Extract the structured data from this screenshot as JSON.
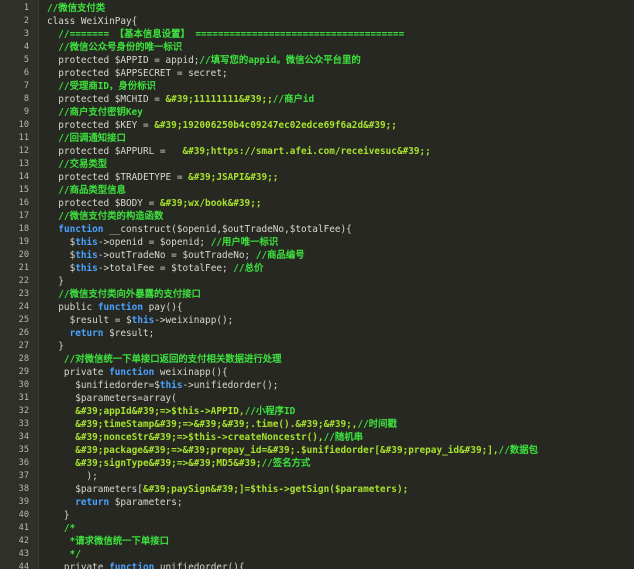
{
  "editor": {
    "lines": [
      {
        "n": "1",
        "tokens": [
          {
            "t": "//微信支付类",
            "c": "cm"
          }
        ]
      },
      {
        "n": "2",
        "tokens": [
          {
            "t": "class WeiXinPay{",
            "c": "pl"
          }
        ]
      },
      {
        "n": "3",
        "tokens": [
          {
            "t": "  //======= 【基本信息设置】 =====================================",
            "c": "cm"
          }
        ]
      },
      {
        "n": "4",
        "tokens": [
          {
            "t": "  //微信公众号身份的唯一标识",
            "c": "cm"
          }
        ]
      },
      {
        "n": "5",
        "tokens": [
          {
            "t": "  protected $APPID = appid;",
            "c": "pl"
          },
          {
            "t": "//填写您的appid。微信公众平台里的",
            "c": "cm"
          }
        ]
      },
      {
        "n": "6",
        "tokens": [
          {
            "t": "  protected $APPSECRET = secret;",
            "c": "pl"
          }
        ]
      },
      {
        "n": "7",
        "tokens": [
          {
            "t": "  //受理商ID，身份标识",
            "c": "cm"
          }
        ]
      },
      {
        "n": "8",
        "tokens": [
          {
            "t": "  protected $MCHID = ",
            "c": "pl"
          },
          {
            "t": "&#39;11111111&#39;;",
            "c": "st"
          },
          {
            "t": "//商户id",
            "c": "cm"
          }
        ]
      },
      {
        "n": "9",
        "tokens": [
          {
            "t": "  //商户支付密钥Key",
            "c": "cm"
          }
        ]
      },
      {
        "n": "10",
        "tokens": [
          {
            "t": "  protected $KEY = ",
            "c": "pl"
          },
          {
            "t": "&#39;192006250b4c09247ec02edce69f6a2d&#39;;",
            "c": "st"
          }
        ]
      },
      {
        "n": "11",
        "tokens": [
          {
            "t": "  //回调通知接口",
            "c": "cm"
          }
        ]
      },
      {
        "n": "12",
        "tokens": [
          {
            "t": "  protected $APPURL =   ",
            "c": "pl"
          },
          {
            "t": "&#39;https://smart.afei.com/receivesuc&#39;;",
            "c": "st"
          }
        ]
      },
      {
        "n": "13",
        "tokens": [
          {
            "t": "  //交易类型",
            "c": "cm"
          }
        ]
      },
      {
        "n": "14",
        "tokens": [
          {
            "t": "  protected $TRADETYPE = ",
            "c": "pl"
          },
          {
            "t": "&#39;JSAPI&#39;;",
            "c": "st"
          }
        ]
      },
      {
        "n": "15",
        "tokens": [
          {
            "t": "  //商品类型信息",
            "c": "cm"
          }
        ]
      },
      {
        "n": "16",
        "tokens": [
          {
            "t": "  protected $BODY = ",
            "c": "pl"
          },
          {
            "t": "&#39;wx/book&#39;;",
            "c": "st"
          }
        ]
      },
      {
        "n": "17",
        "tokens": [
          {
            "t": "  //微信支付类的构造函数",
            "c": "cm"
          }
        ]
      },
      {
        "n": "18",
        "tokens": [
          {
            "t": "  ",
            "c": "pl"
          },
          {
            "t": "function",
            "c": "kw"
          },
          {
            "t": " __construct($openid,$outTradeNo,$totalFee){",
            "c": "pl"
          }
        ]
      },
      {
        "n": "19",
        "tokens": [
          {
            "t": "    $",
            "c": "pl"
          },
          {
            "t": "this",
            "c": "kw"
          },
          {
            "t": "->openid = $openid; ",
            "c": "pl"
          },
          {
            "t": "//用户唯一标识",
            "c": "cm"
          }
        ]
      },
      {
        "n": "20",
        "tokens": [
          {
            "t": "    $",
            "c": "pl"
          },
          {
            "t": "this",
            "c": "kw"
          },
          {
            "t": "->outTradeNo = $outTradeNo; ",
            "c": "pl"
          },
          {
            "t": "//商品编号",
            "c": "cm"
          }
        ]
      },
      {
        "n": "21",
        "tokens": [
          {
            "t": "    $",
            "c": "pl"
          },
          {
            "t": "this",
            "c": "kw"
          },
          {
            "t": "->totalFee = $totalFee; ",
            "c": "pl"
          },
          {
            "t": "//总价",
            "c": "cm"
          }
        ]
      },
      {
        "n": "22",
        "tokens": [
          {
            "t": "  }",
            "c": "pl"
          }
        ]
      },
      {
        "n": "23",
        "tokens": [
          {
            "t": "  //微信支付类向外暴露的支付接口",
            "c": "cm"
          }
        ]
      },
      {
        "n": "24",
        "tokens": [
          {
            "t": "  public ",
            "c": "pl"
          },
          {
            "t": "function",
            "c": "kw"
          },
          {
            "t": " pay(){",
            "c": "pl"
          }
        ]
      },
      {
        "n": "25",
        "tokens": [
          {
            "t": "    $result = $",
            "c": "pl"
          },
          {
            "t": "this",
            "c": "kw"
          },
          {
            "t": "->weixinapp();",
            "c": "pl"
          }
        ]
      },
      {
        "n": "26",
        "tokens": [
          {
            "t": "    ",
            "c": "pl"
          },
          {
            "t": "return",
            "c": "kw"
          },
          {
            "t": " $result;",
            "c": "pl"
          }
        ]
      },
      {
        "n": "27",
        "tokens": [
          {
            "t": "  }",
            "c": "pl"
          }
        ]
      },
      {
        "n": "28",
        "tokens": [
          {
            "t": "   //对微信统一下单接口返回的支付相关数据进行处理",
            "c": "cm"
          }
        ]
      },
      {
        "n": "29",
        "tokens": [
          {
            "t": "   private ",
            "c": "pl"
          },
          {
            "t": "function",
            "c": "kw"
          },
          {
            "t": " weixinapp(){",
            "c": "pl"
          }
        ]
      },
      {
        "n": "30",
        "tokens": [
          {
            "t": "     $unifiedorder=$",
            "c": "pl"
          },
          {
            "t": "this",
            "c": "kw"
          },
          {
            "t": "->unifiedorder();",
            "c": "pl"
          }
        ]
      },
      {
        "n": "31",
        "tokens": [
          {
            "t": "     $parameters=array(",
            "c": "pl"
          }
        ]
      },
      {
        "n": "32",
        "tokens": [
          {
            "t": "     &#39;appId&#39;=>$this->APPID,",
            "c": "st"
          },
          {
            "t": "//小程序ID",
            "c": "cm"
          }
        ]
      },
      {
        "n": "33",
        "tokens": [
          {
            "t": "     &#39;timeStamp&#39;=>&#39;&#39;.time().&#39;&#39;,",
            "c": "st"
          },
          {
            "t": "//时间戳",
            "c": "cm"
          }
        ]
      },
      {
        "n": "34",
        "tokens": [
          {
            "t": "     &#39;nonceStr&#39;=>$this->createNoncestr(),",
            "c": "st"
          },
          {
            "t": "//随机串",
            "c": "cm"
          }
        ]
      },
      {
        "n": "35",
        "tokens": [
          {
            "t": "     &#39;package&#39;=>&#39;prepay_id=&#39;.$unifiedorder[&#39;prepay_id&#39;],",
            "c": "st"
          },
          {
            "t": "//数据包",
            "c": "cm"
          }
        ]
      },
      {
        "n": "36",
        "tokens": [
          {
            "t": "     &#39;signType&#39;=>&#39;MD5&#39;",
            "c": "st"
          },
          {
            "t": "//签名方式",
            "c": "cm"
          }
        ]
      },
      {
        "n": "37",
        "tokens": [
          {
            "t": "       );",
            "c": "pl"
          }
        ]
      },
      {
        "n": "38",
        "tokens": [
          {
            "t": "     $parameters[",
            "c": "pl"
          },
          {
            "t": "&#39;paySign&#39;",
            "c": "st"
          },
          {
            "t": "]=$this->getSign($parameters);",
            "c": "st"
          }
        ]
      },
      {
        "n": "39",
        "tokens": [
          {
            "t": "     ",
            "c": "pl"
          },
          {
            "t": "return",
            "c": "kw"
          },
          {
            "t": " $parameters;",
            "c": "pl"
          }
        ]
      },
      {
        "n": "40",
        "tokens": [
          {
            "t": "   }",
            "c": "pl"
          }
        ]
      },
      {
        "n": "41",
        "tokens": [
          {
            "t": "   /*",
            "c": "cm"
          }
        ]
      },
      {
        "n": "42",
        "tokens": [
          {
            "t": "    *请求微信统一下单接口",
            "c": "cm"
          }
        ]
      },
      {
        "n": "43",
        "tokens": [
          {
            "t": "    */",
            "c": "cm"
          }
        ]
      },
      {
        "n": "44",
        "tokens": [
          {
            "t": "   private ",
            "c": "pl"
          },
          {
            "t": "function",
            "c": "kw"
          },
          {
            "t": " unifiedorder(){",
            "c": "pl"
          }
        ]
      }
    ]
  }
}
